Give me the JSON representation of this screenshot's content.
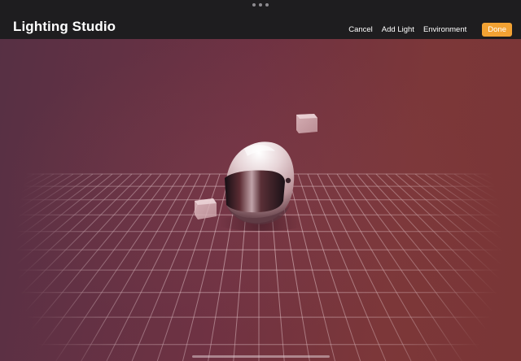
{
  "app": {
    "title": "Lighting Studio"
  },
  "toolbar": {
    "cancel_label": "Cancel",
    "add_light_label": "Add Light",
    "environment_label": "Environment",
    "done_label": "Done"
  },
  "scene": {
    "model": "motorcycle-helmet",
    "lights_count": 2,
    "floor": "grid"
  },
  "colors": {
    "accent": "#f2a233",
    "topbar": "#1e1d1f",
    "background_left": "#573044",
    "background_right": "#7a3636"
  }
}
